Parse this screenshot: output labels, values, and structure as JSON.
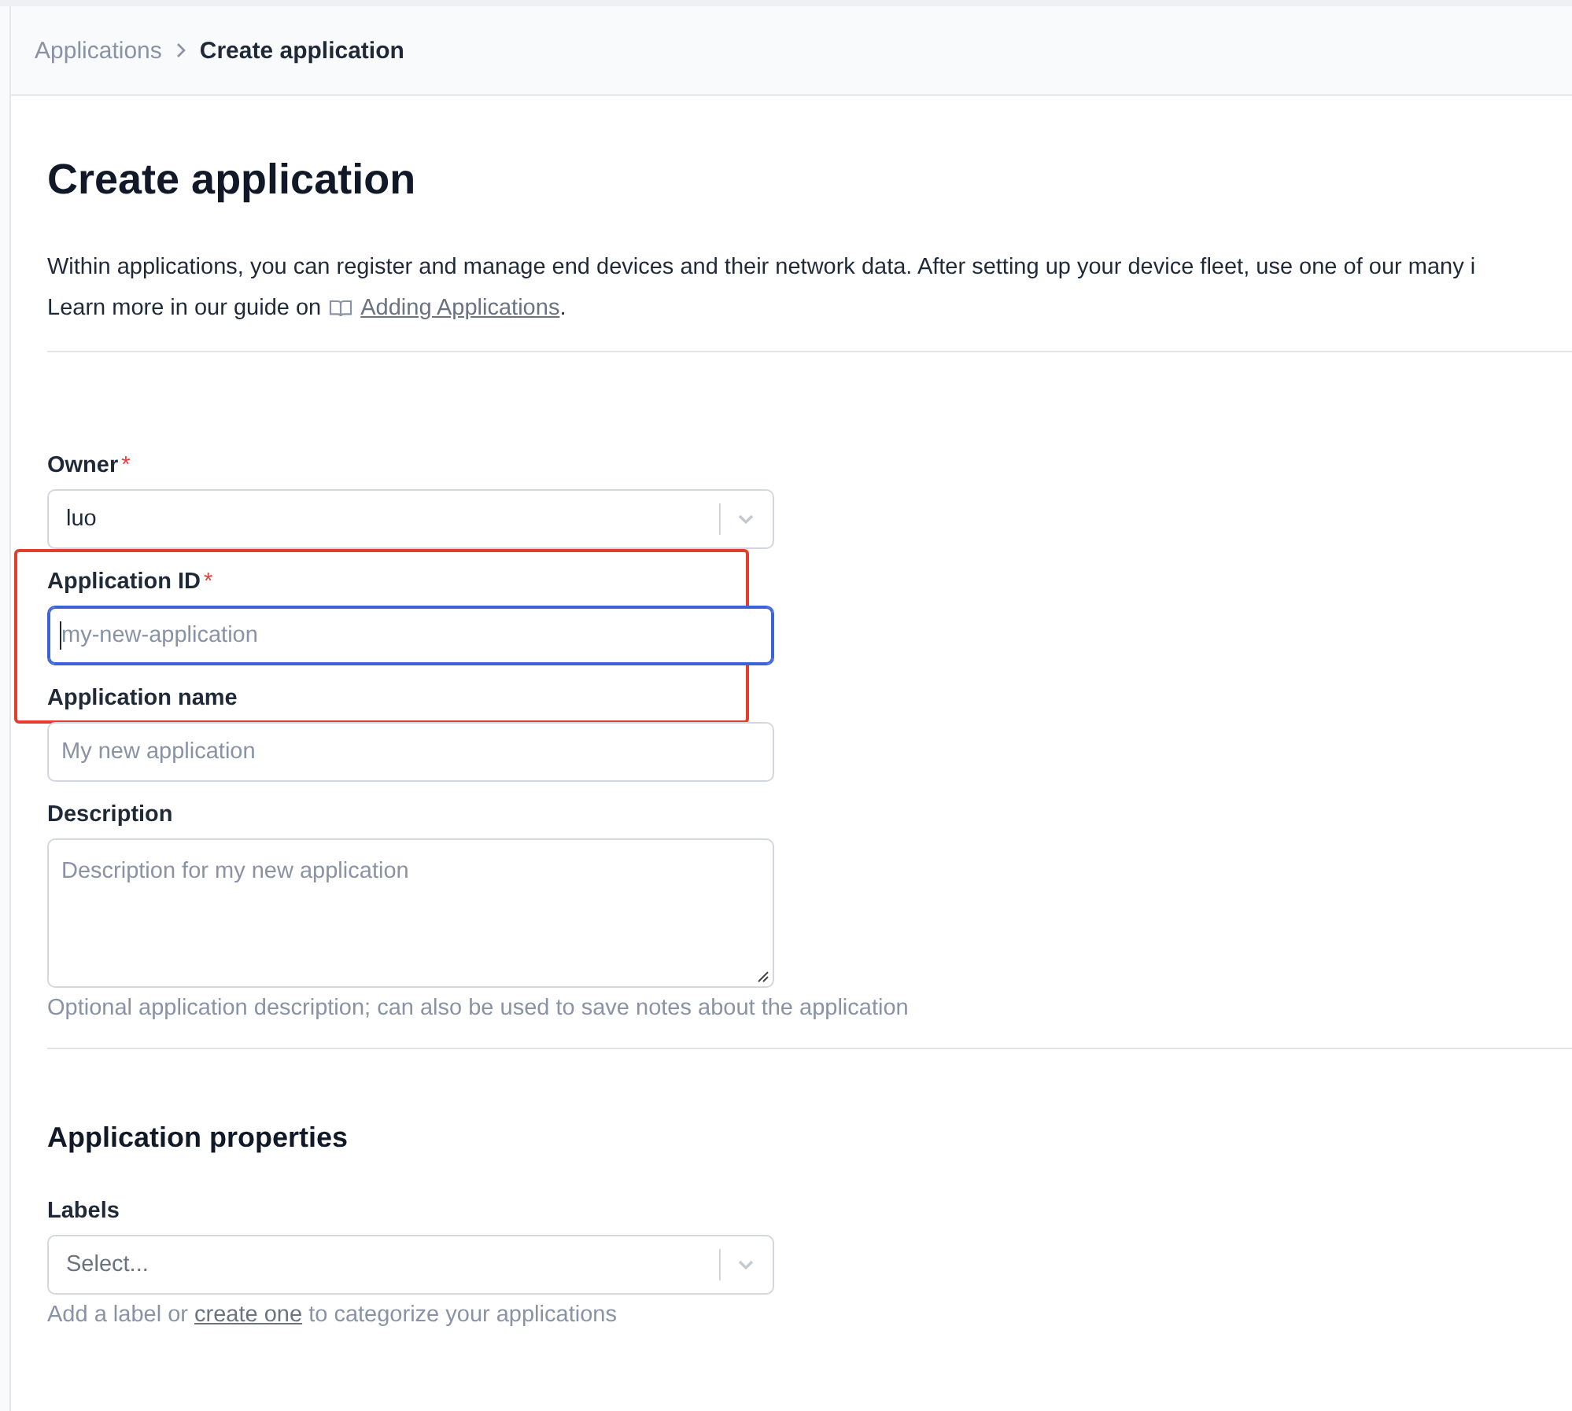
{
  "breadcrumb": [
    {
      "label": "Applications",
      "current": false
    },
    {
      "label": "Create application",
      "current": true
    }
  ],
  "title": "Create application",
  "required_mark": "*",
  "intro": [
    "Within applications, you can register and manage end devices and their network data. After setting up your device fleet, use one of our many i"
  ],
  "guide": {
    "prefix": "Learn more in our guide on",
    "link": "Adding Applications",
    "suffix": "."
  },
  "fields": [
    {
      "kind": "select",
      "label": "Owner",
      "required": true,
      "value": "luo",
      "focused": false,
      "highlighted": false
    },
    {
      "kind": "input",
      "label": "Application ID",
      "required": true,
      "placeholder": "my-new-application",
      "focused": true,
      "highlighted": true
    },
    {
      "kind": "input",
      "label": "Application name",
      "required": false,
      "placeholder": "My new application",
      "focused": false,
      "highlighted": false
    },
    {
      "kind": "textarea",
      "label": "Description",
      "required": false,
      "placeholder": "Description for my new application",
      "focused": false,
      "highlighted": false,
      "hint": "Optional application description; can also be used to save notes about the application"
    }
  ],
  "properties": {
    "title": "Application properties",
    "labels": {
      "label": "Labels",
      "placeholder": "Select...",
      "hint_prefix": "Add a label or",
      "hint_link": "create one",
      "hint_suffix": "to categorize your applications"
    }
  }
}
